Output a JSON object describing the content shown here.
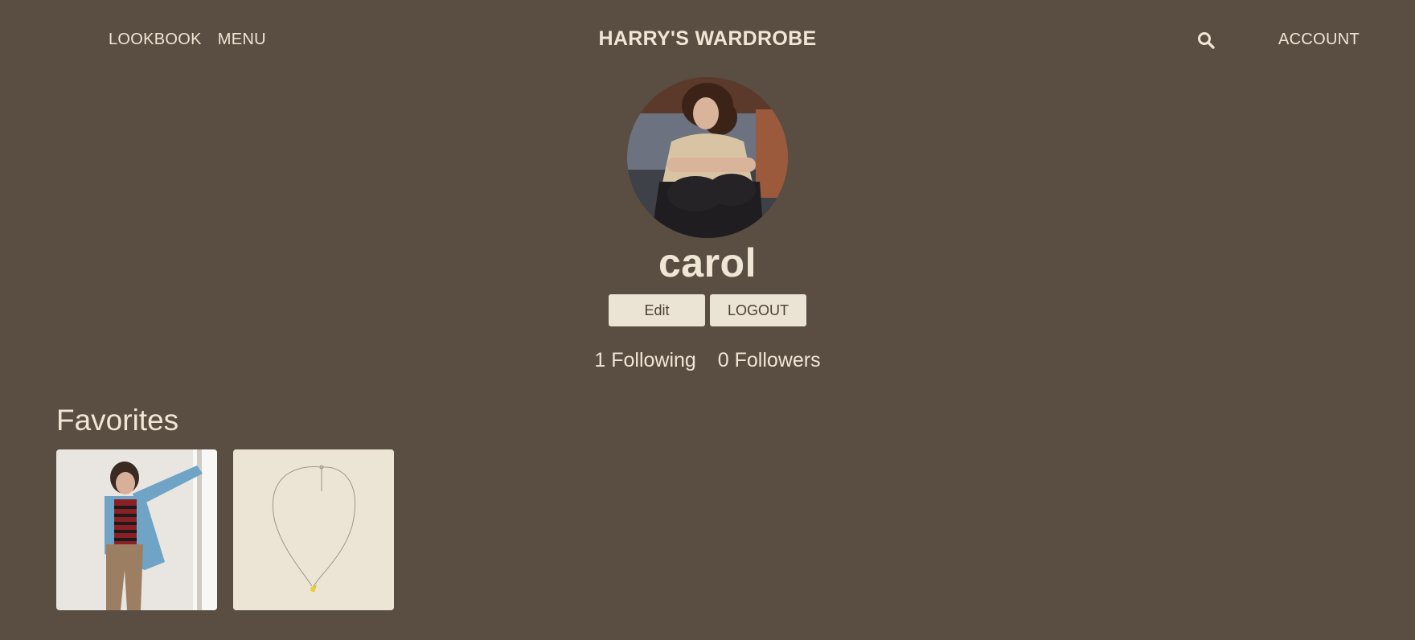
{
  "header": {
    "nav_lookbook": "LOOKBOOK",
    "nav_menu": "MENU",
    "brand": "HARRY'S WARDROBE",
    "search_icon": "search-icon",
    "account": "ACCOUNT"
  },
  "profile": {
    "username": "carol",
    "edit_label": "Edit",
    "logout_label": "LOGOUT",
    "following": "1 Following",
    "followers": "0 Followers"
  },
  "favorites": {
    "heading": "Favorites",
    "items": [
      {
        "kind": "photo"
      },
      {
        "kind": "necklace-photo"
      }
    ]
  },
  "colors": {
    "background": "#5a4d41",
    "text": "#efe6d6",
    "button_bg": "#ebe3d3",
    "button_text": "#4c4034"
  }
}
